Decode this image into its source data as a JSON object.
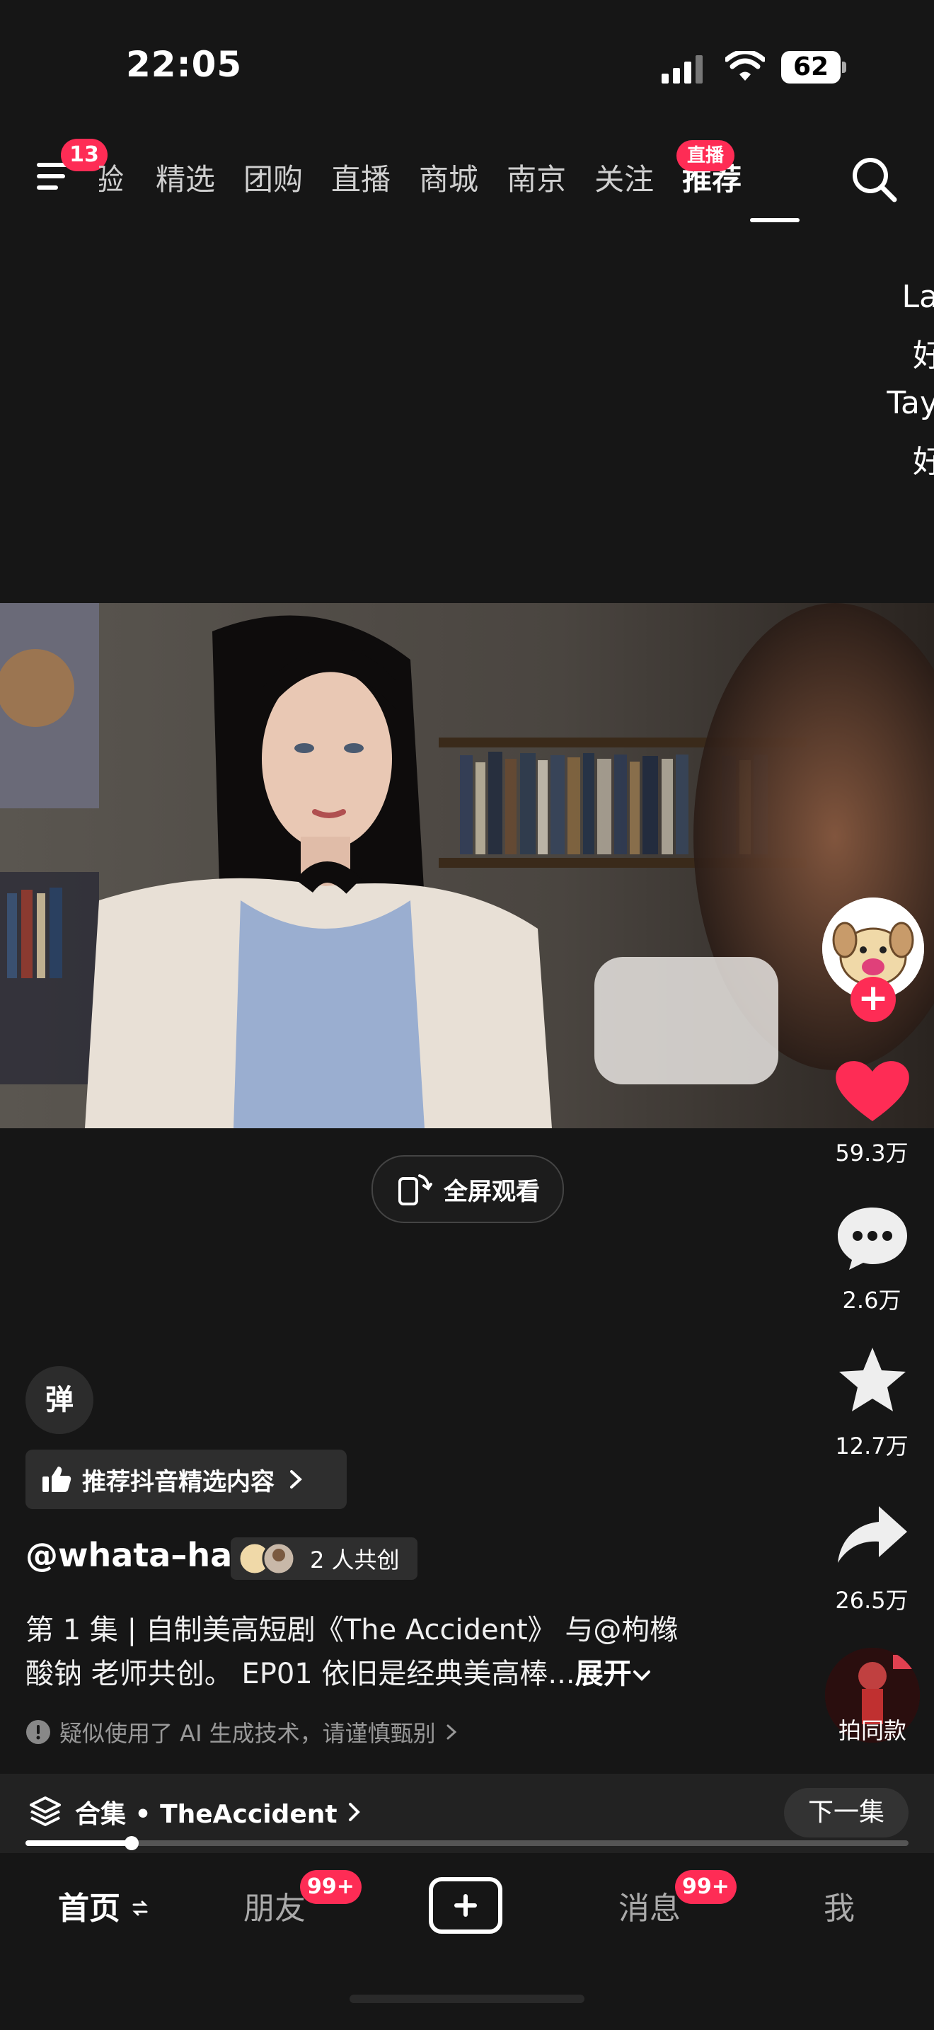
{
  "status_bar": {
    "time": "22:05",
    "battery": "62"
  },
  "top_nav": {
    "menu_badge": "13",
    "tabs": [
      "验",
      "精选",
      "团购",
      "直播",
      "商城",
      "南京",
      "关注",
      "推荐"
    ],
    "live_badge": "直播",
    "active_tab": "推荐"
  },
  "edge_text": [
    "La",
    "好",
    "Tay",
    "好"
  ],
  "player": {
    "fullscreen_label": "全屏观看"
  },
  "right_rail": {
    "likes": "59.3万",
    "comments": "2.6万",
    "favorites": "12.7万",
    "shares": "26.5万",
    "same_style_label": "拍同款"
  },
  "video_info": {
    "danmu_label": "弹",
    "recommend_chip": "推荐抖音精选内容",
    "author": "@whata–ha",
    "collab_label": "2 人共创",
    "description_line1": "第 1 集 | 自制美高短剧《The Accident》 与@枸橼",
    "description_line2": "酸钠 老师共创。 EP01 依旧是经典美高棒...",
    "expand_label": "展开",
    "ai_notice": "疑似使用了 AI 生成技术，请谨慎甄别"
  },
  "collection": {
    "title": "合集 • TheAccident",
    "next_label": "下一集",
    "progress_fraction": 0.12
  },
  "bottom_tabs": {
    "home": "首页",
    "friends": "朋友",
    "friends_badge": "99+",
    "messages": "消息",
    "messages_badge": "99+",
    "me": "我"
  },
  "colors": {
    "accent": "#fe2c55",
    "background": "#161616"
  }
}
